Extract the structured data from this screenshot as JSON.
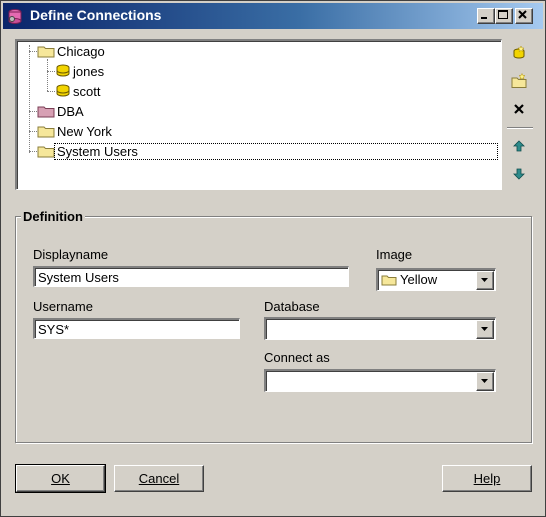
{
  "window": {
    "title": "Define Connections"
  },
  "tree": {
    "nodes": [
      {
        "label": "Chicago",
        "icon": "folder-icon",
        "color": "#f6e79a"
      },
      {
        "label": "jones",
        "icon": "database-icon",
        "color": "#f2d400"
      },
      {
        "label": "scott",
        "icon": "database-icon",
        "color": "#f2d400"
      },
      {
        "label": "DBA",
        "icon": "folder-icon",
        "color": "#d7a0b4"
      },
      {
        "label": "New York",
        "icon": "folder-icon",
        "color": "#f6e79a"
      },
      {
        "label": "System Users",
        "icon": "folder-icon",
        "color": "#f6e79a",
        "selected": true
      }
    ]
  },
  "side_buttons": [
    "new-connection-icon",
    "new-folder-icon",
    "delete-icon",
    "move-up-icon",
    "move-down-icon"
  ],
  "definition": {
    "group_label": "Definition",
    "displayname_label": "Displayname",
    "displayname_value": "System Users",
    "image_label": "Image",
    "image_value": "Yellow",
    "username_label": "Username",
    "username_value": "SYS*",
    "database_label": "Database",
    "database_value": "",
    "connect_as_label": "Connect as",
    "connect_as_value": ""
  },
  "buttons": {
    "ok": "OK",
    "cancel": "Cancel",
    "help": "Help"
  }
}
